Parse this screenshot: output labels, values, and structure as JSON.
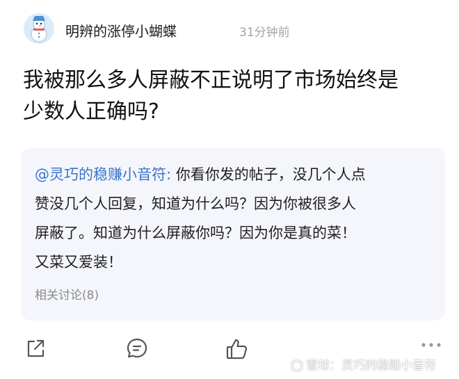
{
  "author": {
    "avatar_icon": "snowman-avatar-icon",
    "name": "明辨的涨停小蝴蝶",
    "time": "31分钟前"
  },
  "post": {
    "title_line1": "我被那么多人屏蔽不正说明了市场始终是",
    "title_line2": "少数人正确吗?"
  },
  "quote": {
    "mention": "@灵巧的稳赚小音符:",
    "line1_rest": " 你看你发的帖子，没几个人点",
    "line2": "赞没几个人回复，知道为什么吗？因为你被很多人",
    "line3": "屏蔽了。知道为什么屏蔽你吗？因为你是真的菜！",
    "line4": "又菜又爱装！",
    "related": "相关讨论(8)"
  },
  "actions": {
    "share_icon": "share-icon",
    "comment_icon": "comment-icon",
    "like_icon": "like-icon",
    "more_icon": "more-icon"
  },
  "watermark": {
    "text": "雪球：灵巧的稳赚小音符"
  },
  "colors": {
    "mention": "#3a73cc",
    "card_bg": "#f4f6fb",
    "muted": "#a3a3a3"
  }
}
